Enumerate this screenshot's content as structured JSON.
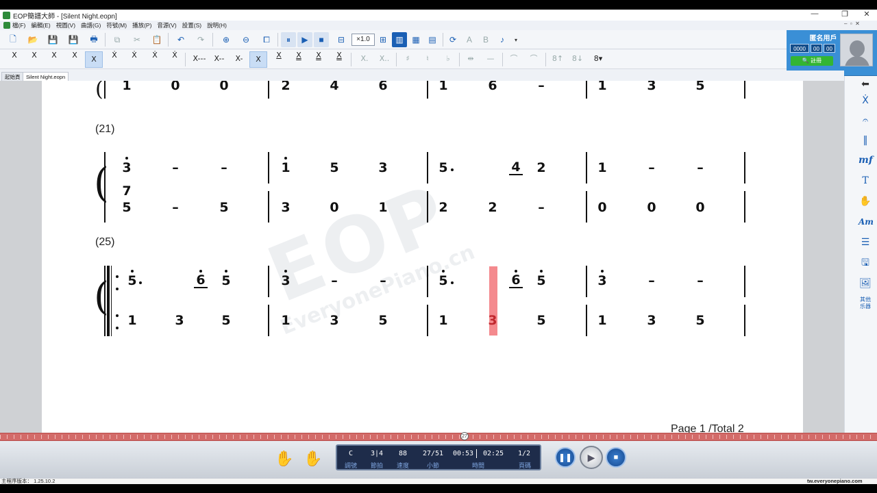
{
  "window": {
    "title": "EOP簡譜大師 - [Silent Night.eopn]",
    "controls": [
      "—",
      "❐",
      "✕"
    ]
  },
  "menu": [
    "檔(F)",
    "編輯(E)",
    "視圖(V)",
    "曲譜(G)",
    "符號(M)",
    "播放(P)",
    "音源(V)",
    "設置(S)",
    "說明(H)"
  ],
  "toolbar": {
    "speed": "×1.0"
  },
  "note_toolbar": [
    "X",
    "X",
    "X",
    "X",
    "X",
    "Ẋ",
    "Ẋ",
    "Ẋ",
    "Ẋ",
    "X---",
    "X--",
    "X-",
    "X",
    "X",
    "X",
    "X",
    "X",
    "X.",
    "X..",
    "♯",
    "♮",
    "♭",
    "⇹",
    "—",
    "⌒",
    "⌒",
    "8↑",
    "8↓",
    "8▾"
  ],
  "user": {
    "title": "匿名用戶",
    "counters": [
      "0000",
      "00",
      "00"
    ],
    "login_label": "註冊"
  },
  "tabs": [
    "起始頁",
    "Silent Night.eopn"
  ],
  "score": {
    "row_top": {
      "notes": [
        "1",
        "0",
        "0",
        "2",
        "4",
        "6",
        "1",
        "6",
        "–",
        "1",
        "3",
        "5"
      ]
    },
    "system21": {
      "label": "(21)",
      "upper": [
        "3",
        "–",
        "–",
        "1",
        "5",
        "3",
        "5",
        "4",
        "2",
        "1",
        "–",
        "–"
      ],
      "lower_top": "7",
      "lower": [
        "5",
        "–",
        "5",
        "3",
        "0",
        "1",
        "2",
        "2",
        "–",
        "0",
        "0",
        "0"
      ]
    },
    "system25": {
      "label": "(25)",
      "upper": [
        "5",
        "6",
        "5",
        "3",
        "–",
        "–",
        "5",
        "6",
        "5",
        "3",
        "–",
        "–"
      ],
      "lower": [
        "1",
        "3",
        "5",
        "1",
        "3",
        "5",
        "1",
        "3",
        "5",
        "1",
        "3",
        "5"
      ]
    },
    "watermark_big": "EOP",
    "watermark_small": "EveryonePiano.cn",
    "page_label": "Page 1 /Total 2"
  },
  "right_panel": {
    "icons": [
      "arrow-left",
      "note-x",
      "fermata",
      "repeat-bar",
      "mf",
      "text-T",
      "hand",
      "Am",
      "list",
      "save",
      "image"
    ],
    "mf_label": "mf",
    "am_label": "Am",
    "t_label": "T",
    "more_label": "其他\n乐器"
  },
  "timeline": {
    "marker": "27"
  },
  "player": {
    "values": [
      "C",
      "3|4",
      "88",
      "27/51",
      "00:53",
      "02:25",
      "1/2"
    ],
    "labels": [
      "調號",
      "節拍",
      "速度",
      "小節",
      "時間",
      "頁碼"
    ]
  },
  "status": {
    "version": "主程序版本： 1.25.10.2",
    "site": "tw.everyonepiano.com"
  },
  "colors": {
    "accent": "#1a5fb4",
    "cursor": "#f48a8e",
    "timeline": "#d36b69"
  }
}
